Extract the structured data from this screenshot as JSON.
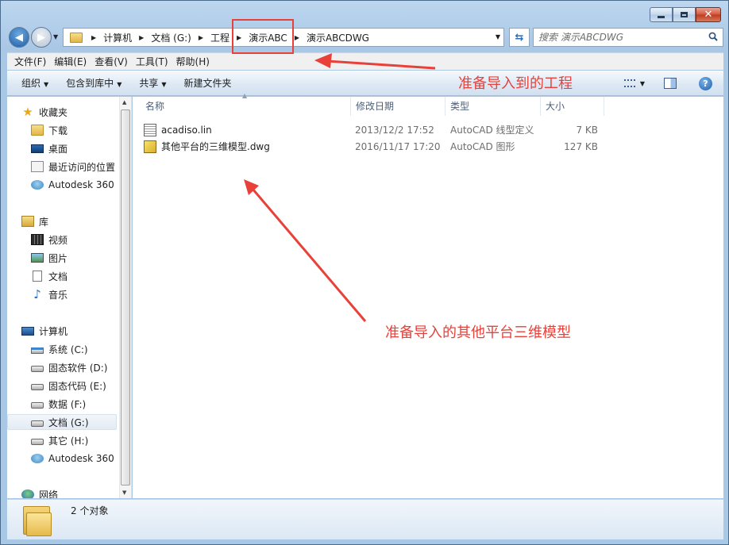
{
  "window": {
    "caption_buttons": [
      "minimize",
      "maximize",
      "close"
    ]
  },
  "address_bar": {
    "crumbs": [
      "计算机",
      "文档 (G:)",
      "工程",
      "演示ABC",
      "演示ABCDWG"
    ]
  },
  "search": {
    "placeholder": "搜索 演示ABCDWG"
  },
  "menu": [
    "文件(F)",
    "编辑(E)",
    "查看(V)",
    "工具(T)",
    "帮助(H)"
  ],
  "commands": {
    "organize": "组织",
    "include_in_library": "包含到库中",
    "share": "共享",
    "new_folder": "新建文件夹"
  },
  "nav_pane": {
    "favorites": {
      "label": "收藏夹",
      "items": [
        "下载",
        "桌面",
        "最近访问的位置",
        "Autodesk 360"
      ]
    },
    "libraries": {
      "label": "库",
      "items": [
        "视频",
        "图片",
        "文档",
        "音乐"
      ]
    },
    "computer": {
      "label": "计算机",
      "items": [
        "系统 (C:)",
        "固态软件 (D:)",
        "固态代码 (E:)",
        "数据 (F:)",
        "文档 (G:)",
        "其它 (H:)",
        "Autodesk 360"
      ],
      "selected": "文档 (G:)"
    },
    "network": {
      "label": "网络"
    }
  },
  "columns": [
    "名称",
    "修改日期",
    "类型",
    "大小"
  ],
  "files": [
    {
      "name": "acadiso.lin",
      "modified": "2013/12/2 17:52",
      "type": "AutoCAD 线型定义",
      "size": "7 KB"
    },
    {
      "name": "其他平台的三维模型.dwg",
      "modified": "2016/11/17 17:20",
      "type": "AutoCAD 图形",
      "size": "127 KB"
    }
  ],
  "status": {
    "text": "2 个对象"
  },
  "annotations": {
    "top": "准备导入到的工程",
    "middle": "准备导入的其他平台三维模型",
    "color": "#e8413a"
  }
}
